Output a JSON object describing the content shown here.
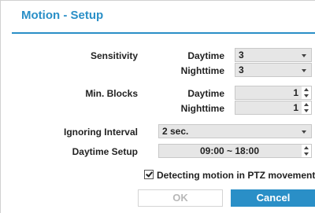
{
  "dialog": {
    "title": "Motion - Setup"
  },
  "sensitivity": {
    "label": "Sensitivity",
    "daytime_label": "Daytime",
    "daytime_value": "3",
    "nighttime_label": "Nighttime",
    "nighttime_value": "3"
  },
  "min_blocks": {
    "label": "Min. Blocks",
    "daytime_label": "Daytime",
    "daytime_value": "1",
    "nighttime_label": "Nighttime",
    "nighttime_value": "1"
  },
  "ignoring_interval": {
    "label": "Ignoring Interval",
    "value": "2 sec."
  },
  "daytime_setup": {
    "label": "Daytime Setup",
    "value": "09:00 ~ 18:00"
  },
  "ptz": {
    "label": "Detecting motion in PTZ movement",
    "checked": true
  },
  "buttons": {
    "ok": "OK",
    "cancel": "Cancel"
  },
  "colors": {
    "accent": "#2a8fc7",
    "field_bg": "#e6e6e6",
    "disabled_text": "#b8b8b8"
  }
}
